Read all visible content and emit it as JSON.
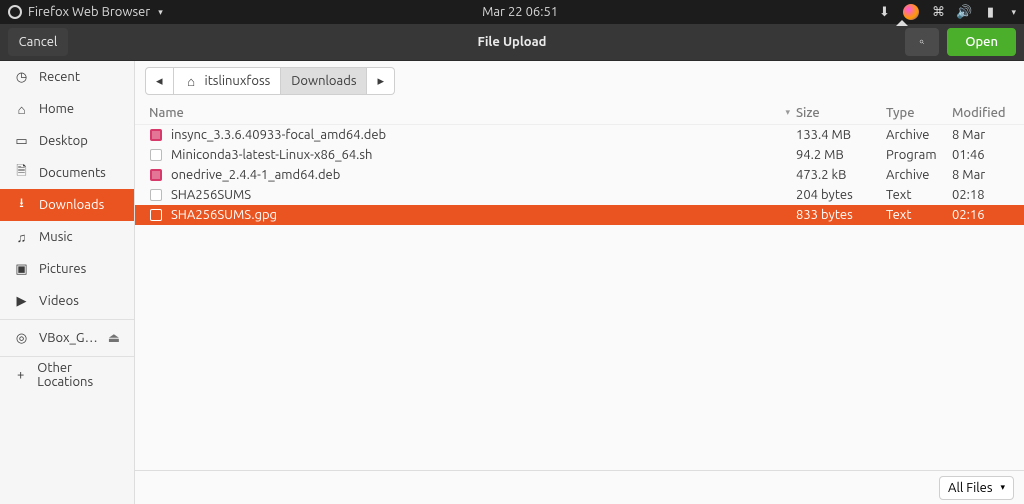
{
  "menubar": {
    "app_name": "Firefox Web Browser",
    "clock": "Mar 22  06:51"
  },
  "dialog": {
    "cancel": "Cancel",
    "title": "File Upload",
    "open": "Open"
  },
  "sidebar": {
    "items": [
      {
        "label": "Recent",
        "icon": "clock-icon"
      },
      {
        "label": "Home",
        "icon": "home-icon"
      },
      {
        "label": "Desktop",
        "icon": "desktop-icon"
      },
      {
        "label": "Documents",
        "icon": "documents-icon"
      },
      {
        "label": "Downloads",
        "icon": "downloads-icon",
        "active": true
      },
      {
        "label": "Music",
        "icon": "music-icon"
      },
      {
        "label": "Pictures",
        "icon": "pictures-icon"
      },
      {
        "label": "Videos",
        "icon": "videos-icon"
      }
    ],
    "volume": {
      "label": "VBox_G…",
      "icon": "disk-icon"
    },
    "other": {
      "label": "Other Locations",
      "icon": "plus-icon"
    }
  },
  "path": {
    "segments": [
      "itslinuxfoss",
      "Downloads"
    ]
  },
  "columns": {
    "name": "Name",
    "size": "Size",
    "type": "Type",
    "modified": "Modified"
  },
  "files": [
    {
      "name": "insync_3.3.6.40933-focal_amd64.deb",
      "size": "133.4 MB",
      "type": "Archive",
      "mod": "8 Mar",
      "kind": "deb"
    },
    {
      "name": "Miniconda3-latest-Linux-x86_64.sh",
      "size": "94.2 MB",
      "type": "Program",
      "mod": "01:46",
      "kind": "txt"
    },
    {
      "name": "onedrive_2.4.4-1_amd64.deb",
      "size": "473.2 kB",
      "type": "Archive",
      "mod": "8 Mar",
      "kind": "deb"
    },
    {
      "name": "SHA256SUMS",
      "size": "204 bytes",
      "type": "Text",
      "mod": "02:18",
      "kind": "txt"
    },
    {
      "name": "SHA256SUMS.gpg",
      "size": "833 bytes",
      "type": "Text",
      "mod": "02:16",
      "kind": "txt",
      "selected": true
    }
  ],
  "footer": {
    "filter": "All Files"
  }
}
